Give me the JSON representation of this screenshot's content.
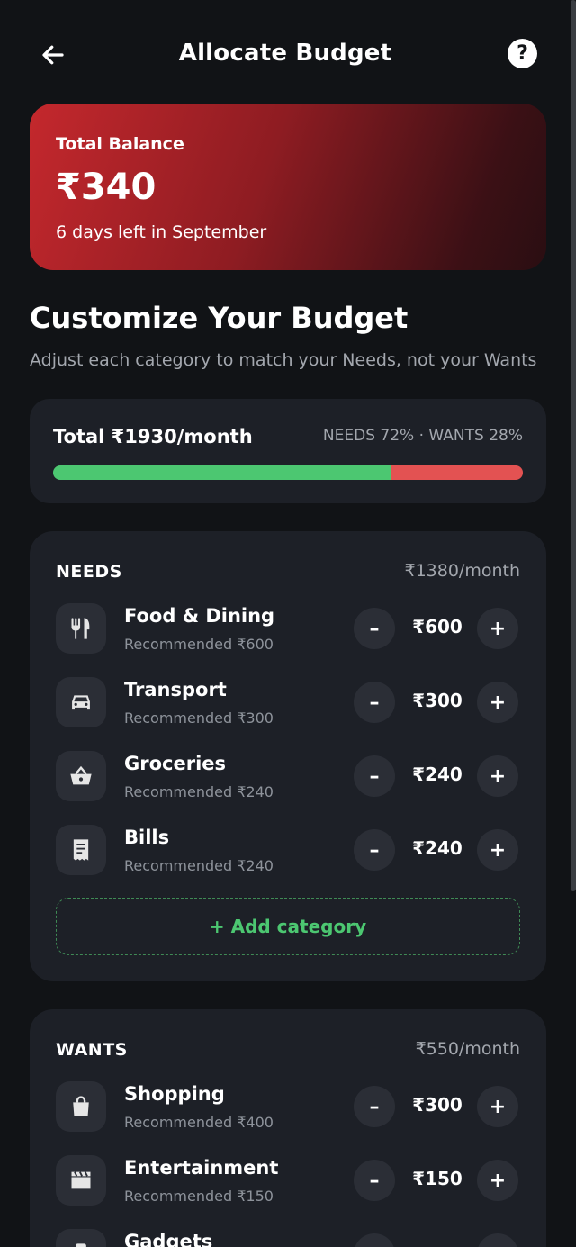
{
  "header": {
    "title": "Allocate Budget",
    "help_label": "?"
  },
  "balance": {
    "label": "Total Balance",
    "amount": "₹340",
    "subtitle": "6 days left in September"
  },
  "intro": {
    "title": "Customize Your Budget",
    "subtitle": "Adjust each category to match your Needs, not your Wants"
  },
  "summary": {
    "total": "Total ₹1930/month",
    "split": "NEEDS 72% · WANTS 28%",
    "needs_percent": 72,
    "wants_percent": 28,
    "needs_color": "#4cc771",
    "wants_color": "#e35252"
  },
  "needs": {
    "title": "NEEDS",
    "total": "₹1380/month",
    "items": [
      {
        "icon": "fork-knife-icon",
        "name": "Food & Dining",
        "recommended": "Recommended ₹600",
        "value": "₹600"
      },
      {
        "icon": "car-icon",
        "name": "Transport",
        "recommended": "Recommended ₹300",
        "value": "₹300"
      },
      {
        "icon": "basket-icon",
        "name": "Groceries",
        "recommended": "Recommended ₹240",
        "value": "₹240"
      },
      {
        "icon": "receipt-icon",
        "name": "Bills",
        "recommended": "Recommended ₹240",
        "value": "₹240"
      }
    ],
    "add_label": "+ Add category"
  },
  "wants": {
    "title": "WANTS",
    "total": "₹550/month",
    "items": [
      {
        "icon": "shopping-bag-icon",
        "name": "Shopping",
        "recommended": "Recommended ₹400",
        "value": "₹300"
      },
      {
        "icon": "clapperboard-icon",
        "name": "Entertainment",
        "recommended": "Recommended ₹150",
        "value": "₹150"
      },
      {
        "icon": "gadget-icon",
        "name": "Gadgets",
        "recommended": "",
        "value": ""
      }
    ]
  },
  "stepper": {
    "minus": "–",
    "plus": "+"
  }
}
